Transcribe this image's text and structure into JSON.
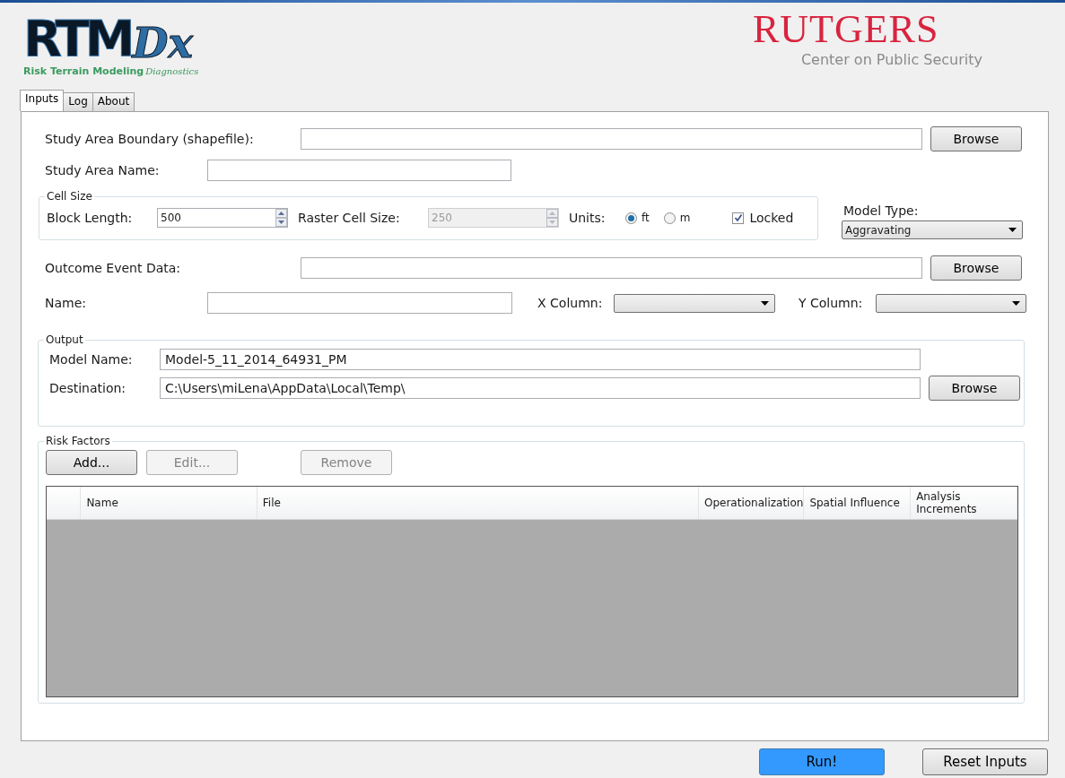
{
  "logo": {
    "main": "RTM",
    "accent": "Dx",
    "tagline": "Risk Terrain Modeling",
    "tagline_accent": "Diagnostics"
  },
  "brand": {
    "name": "RUTGERS",
    "subtitle": "Center on Public Security"
  },
  "tabs": [
    {
      "label": "Inputs",
      "selected": true
    },
    {
      "label": "Log",
      "selected": false
    },
    {
      "label": "About",
      "selected": false
    }
  ],
  "study_area": {
    "boundary_label": "Study Area Boundary (shapefile):",
    "boundary_button": "Browse",
    "name_label": "Study Area Name:"
  },
  "cell_size": {
    "title": "Cell Size",
    "block_length_label": "Block Length:",
    "block_length": "500",
    "raster_label": "Raster Cell Size:",
    "raster_value": "250",
    "raster_disabled": true,
    "units_label": "Units:",
    "units": [
      {
        "label": "ft",
        "selected": true
      },
      {
        "label": "m",
        "selected": false
      }
    ],
    "locked": {
      "label": "Locked",
      "checked": true
    }
  },
  "model_type": {
    "label": "Model Type:",
    "value": "Aggravating"
  },
  "outcome": {
    "label": "Outcome Event Data:",
    "button": "Browse",
    "name_label": "Name:",
    "x_label": "X Column:",
    "y_label": "Y Column:"
  },
  "output": {
    "title": "Output",
    "model_name_label": "Model Name:",
    "model_name": "Model-5_11_2014_64931_PM",
    "destination_label": "Destination:",
    "destination": "C:\\Users\\miLena\\AppData\\Local\\Temp\\",
    "button": "Browse"
  },
  "risk_factors": {
    "title": "Risk Factors",
    "buttons": [
      {
        "label": "Add...",
        "disabled": false
      },
      {
        "label": "Edit...",
        "disabled": true
      },
      {
        "label": "Remove",
        "disabled": true
      }
    ],
    "columns": [
      "Name",
      "File",
      "Operationalization",
      "Spatial Influence",
      "Analysis Increments"
    ]
  },
  "footer_buttons": [
    {
      "label": "Run!",
      "kind": "primary"
    },
    {
      "label": "Reset Inputs",
      "kind": "normal"
    }
  ]
}
